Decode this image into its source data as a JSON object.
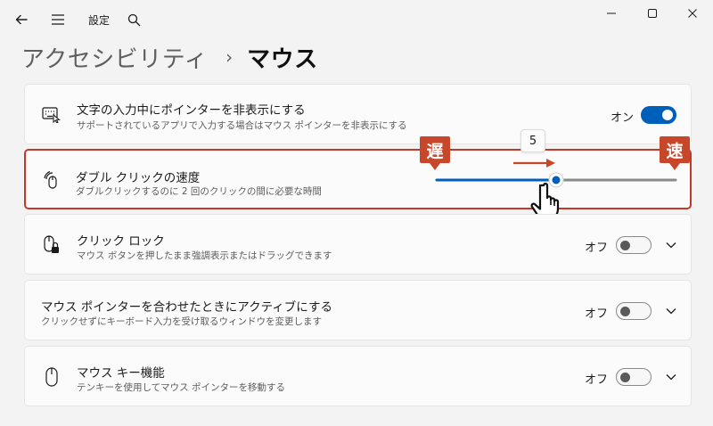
{
  "window": {
    "title": "設定"
  },
  "breadcrumb": {
    "parent": "アクセシビリティ",
    "separator": "›",
    "current": "マウス"
  },
  "settings": [
    {
      "title": "文字の入力中にポインターを非表示にする",
      "description": "サポートされているアプリで入力する場合はマウス ポインターを非表示にする",
      "state": "オン",
      "toggle": "on",
      "icon": "hide-pointer-icon"
    },
    {
      "title": "ダブル クリックの速度",
      "description": "ダブルクリックするのに 2 回のクリックの間に必要な時間",
      "slider_value": "5",
      "slider_fraction": 0.5,
      "slow_label": "遅",
      "fast_label": "速",
      "icon": "double-click-icon"
    },
    {
      "title": "クリック ロック",
      "description": "マウス ボタンを押したまま強調表示またはドラッグできます",
      "state": "オフ",
      "toggle": "off",
      "icon": "click-lock-icon"
    },
    {
      "title": "マウス ポインターを合わせたときにアクティブにする",
      "description": "クリックせずにキーボード入力を受け取るウィンドウを変更します",
      "state": "オフ",
      "toggle": "off"
    },
    {
      "title": "マウス キー機能",
      "description": "テンキーを使用してマウス ポインターを移動する",
      "state": "オフ",
      "toggle": "off",
      "icon": "mouse-icon"
    }
  ],
  "colors": {
    "accent": "#005fb8",
    "annotation": "#c8472a"
  }
}
